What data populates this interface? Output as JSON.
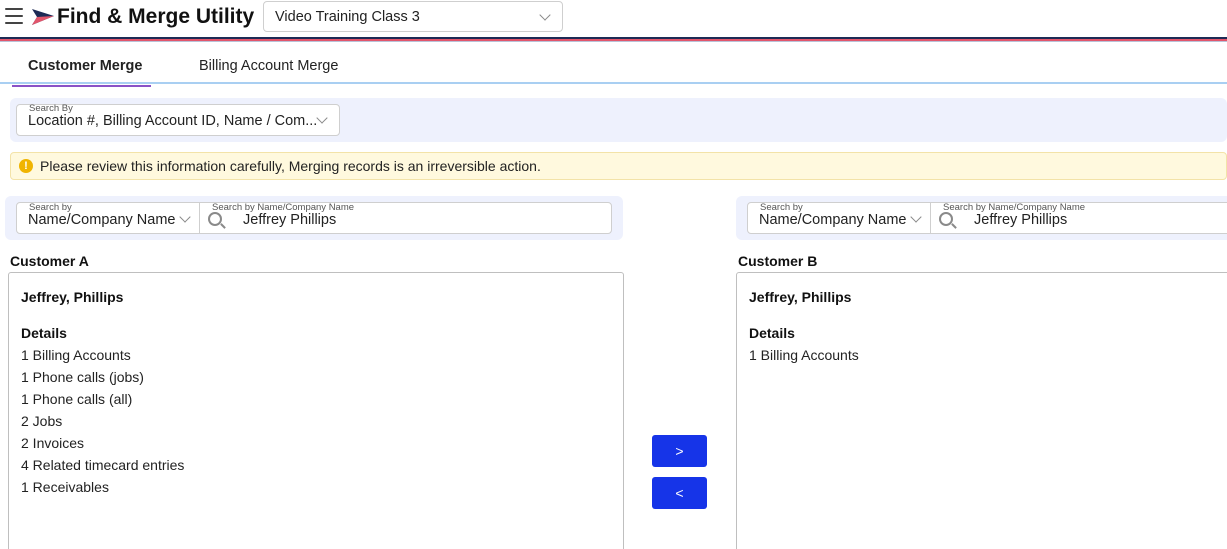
{
  "colors": {
    "accent": "#1634e8",
    "tab_underline": "#8a52c6",
    "tabs_rule": "#a9cff2",
    "band_bg": "#eef1fd",
    "alert_bg": "#fff9de",
    "alert_icon": "#f0b400",
    "stripe_dark": "#1d2a55",
    "stripe_red": "#e2556b",
    "stripe_light": "#b9c2d8"
  },
  "header": {
    "title": "Find & Merge Utility",
    "database_select": "Video Training Class 3"
  },
  "tabs": [
    {
      "label": "Customer Merge",
      "active": true
    },
    {
      "label": "Billing Account Merge",
      "active": false
    }
  ],
  "search_by": {
    "label": "Search By",
    "value": "Location #, Billing Account ID, Name / Com..."
  },
  "alert": {
    "icon": "warning-icon",
    "text": "Please review this information carefully, Merging records is an irreversible action."
  },
  "left_search": {
    "mode_label": "Search by",
    "mode_value": "Name/Company Name",
    "query_label": "Search by Name/Company Name",
    "query_value": "Jeffrey Phillips"
  },
  "right_search": {
    "mode_label": "Search by",
    "mode_value": "Name/Company Name",
    "query_label": "Search by Name/Company Name",
    "query_value": "Jeffrey Phillips"
  },
  "customer_a": {
    "heading": "Customer A",
    "name": "Jeffrey, Phillips",
    "details_heading": "Details",
    "details": [
      "1 Billing Accounts",
      "1 Phone calls (jobs)",
      "1 Phone calls (all)",
      "2 Jobs",
      "2 Invoices",
      "4 Related timecard entries",
      "1 Receivables"
    ]
  },
  "customer_b": {
    "heading": "Customer B",
    "name": "Jeffrey, Phillips",
    "details_heading": "Details",
    "details": [
      "1 Billing Accounts"
    ]
  },
  "actions": {
    "move_right": ">",
    "move_left": "<"
  }
}
